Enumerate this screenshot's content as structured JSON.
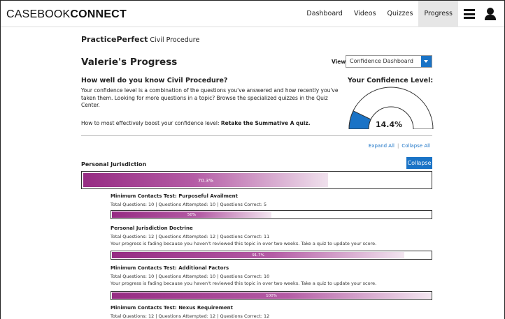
{
  "header": {
    "logo_light": "CASEBOOK",
    "logo_bold": "CONNECT",
    "nav": [
      "Dashboard",
      "Videos",
      "Quizzes",
      "Progress"
    ],
    "active_nav": "Progress",
    "icons": [
      "hamburger-menu-icon",
      "user-icon"
    ]
  },
  "brand": {
    "name": "PracticePerfect",
    "subject": "Civil Procedure"
  },
  "page_title": "Valerie's Progress",
  "view": {
    "label": "View:",
    "selected": "Confidence Dashboard"
  },
  "intro": {
    "heading": "How well do you know Civil Procedure?",
    "body": "Your confidence level is a combination of the questions you've answered and how recently you've taken them. Looking for more questions in a topic? Browse the specialized quizzes in the Quiz Center.",
    "boost_prefix": "How to most effectively boost your confidence level: ",
    "boost_action": "Retake the Summative A quiz."
  },
  "confidence": {
    "title": "Your Confidence Level:",
    "value_text": "14.4%",
    "value": 14.4,
    "fill_color": "#1a73c6"
  },
  "links": {
    "expand_all": "Expand All",
    "separator": "|",
    "collapse_all": "Collapse All"
  },
  "section": {
    "title": "Personal Jurisdiction",
    "collapse_label": "Collapse",
    "progress_text": "70.3%",
    "progress": 70.3
  },
  "topics": [
    {
      "title": "Minimum Contacts Test: Purposeful Availment",
      "stats": "Total Questions: 10  |  Questions Attempted: 10  |  Questions Correct: 5",
      "warning": "",
      "progress_text": "50%",
      "progress": 50
    },
    {
      "title": "Personal Jurisdiction Doctrine",
      "stats": "Total Questions: 12  |  Questions Attempted: 12  |  Questions Correct: 11",
      "warning": "Your progress is fading because you haven't reviewed this topic in over two weeks. Take a quiz to update your score.",
      "progress_text": "91.7%",
      "progress": 91.7
    },
    {
      "title": "Minimum Contacts Test: Additional Factors",
      "stats": "Total Questions: 10  |  Questions Attempted: 10  |  Questions Correct: 10",
      "warning": "Your progress is fading because you haven't reviewed this topic in over two weeks. Take a quiz to update your score.",
      "progress_text": "100%",
      "progress": 100
    },
    {
      "title": "Minimum Contacts Test: Nexus Requirement",
      "stats": "Total Questions: 12  |  Questions Attempted: 12  |  Questions Correct: 12",
      "warning": "",
      "progress_text": "",
      "progress": null
    }
  ],
  "colors": {
    "accent": "#1a73c6",
    "progress": "#962c83"
  }
}
